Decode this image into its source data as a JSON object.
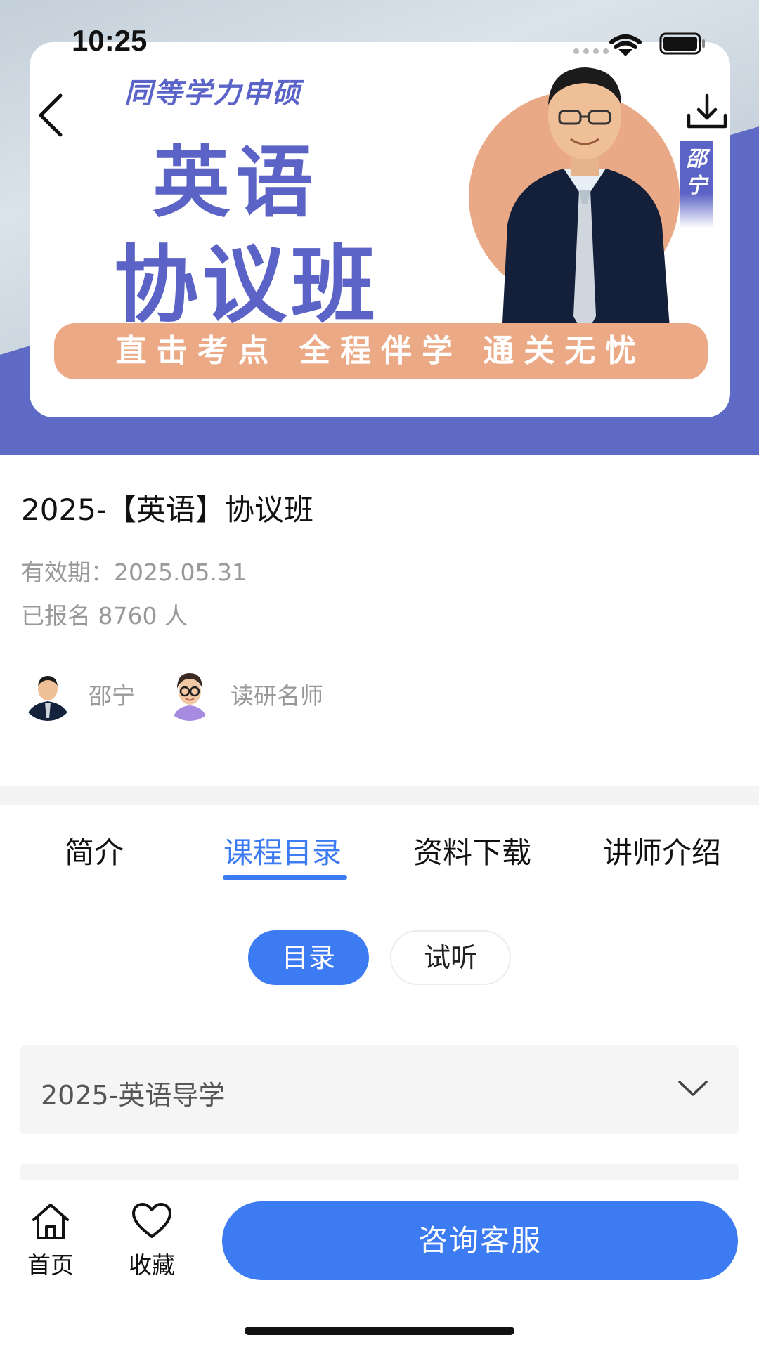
{
  "status_bar": {
    "time": "10:25"
  },
  "hero": {
    "top_title": "同等学力申硕",
    "main_line_1": "英语",
    "main_line_2": "协议班",
    "teacher_tag": "邵宁",
    "slogan": "直击考点 全程伴学 通关无忧"
  },
  "course": {
    "title": "2025-【英语】协议班",
    "validity": "有效期：2025.05.31",
    "enrolled": "已报名 8760 人",
    "teachers": [
      {
        "name": "邵宁"
      },
      {
        "name": "读研名师"
      }
    ]
  },
  "tabs": [
    {
      "label": "简介"
    },
    {
      "label": "课程目录",
      "active": true
    },
    {
      "label": "资料下载"
    },
    {
      "label": "讲师介绍"
    }
  ],
  "segments": [
    {
      "label": "目录",
      "active": true
    },
    {
      "label": "试听"
    }
  ],
  "chapters": [
    {
      "label": "2025-英语导学"
    }
  ],
  "bottom_bar": {
    "home_label": "首页",
    "favorite_label": "收藏",
    "consult_label": "咨询客服"
  },
  "colors": {
    "accent": "#3d7bf2",
    "brand_purple": "#5b63c6",
    "brand_orange": "#eba986"
  }
}
